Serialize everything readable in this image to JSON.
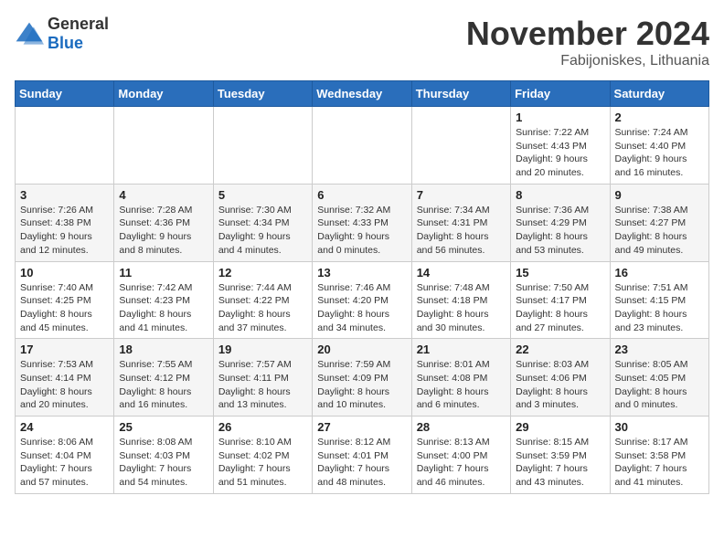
{
  "logo": {
    "text_general": "General",
    "text_blue": "Blue"
  },
  "title": "November 2024",
  "subtitle": "Fabijoniskes, Lithuania",
  "days_of_week": [
    "Sunday",
    "Monday",
    "Tuesday",
    "Wednesday",
    "Thursday",
    "Friday",
    "Saturday"
  ],
  "weeks": [
    [
      {
        "day": "",
        "info": ""
      },
      {
        "day": "",
        "info": ""
      },
      {
        "day": "",
        "info": ""
      },
      {
        "day": "",
        "info": ""
      },
      {
        "day": "",
        "info": ""
      },
      {
        "day": "1",
        "info": "Sunrise: 7:22 AM\nSunset: 4:43 PM\nDaylight: 9 hours\nand 20 minutes."
      },
      {
        "day": "2",
        "info": "Sunrise: 7:24 AM\nSunset: 4:40 PM\nDaylight: 9 hours\nand 16 minutes."
      }
    ],
    [
      {
        "day": "3",
        "info": "Sunrise: 7:26 AM\nSunset: 4:38 PM\nDaylight: 9 hours\nand 12 minutes."
      },
      {
        "day": "4",
        "info": "Sunrise: 7:28 AM\nSunset: 4:36 PM\nDaylight: 9 hours\nand 8 minutes."
      },
      {
        "day": "5",
        "info": "Sunrise: 7:30 AM\nSunset: 4:34 PM\nDaylight: 9 hours\nand 4 minutes."
      },
      {
        "day": "6",
        "info": "Sunrise: 7:32 AM\nSunset: 4:33 PM\nDaylight: 9 hours\nand 0 minutes."
      },
      {
        "day": "7",
        "info": "Sunrise: 7:34 AM\nSunset: 4:31 PM\nDaylight: 8 hours\nand 56 minutes."
      },
      {
        "day": "8",
        "info": "Sunrise: 7:36 AM\nSunset: 4:29 PM\nDaylight: 8 hours\nand 53 minutes."
      },
      {
        "day": "9",
        "info": "Sunrise: 7:38 AM\nSunset: 4:27 PM\nDaylight: 8 hours\nand 49 minutes."
      }
    ],
    [
      {
        "day": "10",
        "info": "Sunrise: 7:40 AM\nSunset: 4:25 PM\nDaylight: 8 hours\nand 45 minutes."
      },
      {
        "day": "11",
        "info": "Sunrise: 7:42 AM\nSunset: 4:23 PM\nDaylight: 8 hours\nand 41 minutes."
      },
      {
        "day": "12",
        "info": "Sunrise: 7:44 AM\nSunset: 4:22 PM\nDaylight: 8 hours\nand 37 minutes."
      },
      {
        "day": "13",
        "info": "Sunrise: 7:46 AM\nSunset: 4:20 PM\nDaylight: 8 hours\nand 34 minutes."
      },
      {
        "day": "14",
        "info": "Sunrise: 7:48 AM\nSunset: 4:18 PM\nDaylight: 8 hours\nand 30 minutes."
      },
      {
        "day": "15",
        "info": "Sunrise: 7:50 AM\nSunset: 4:17 PM\nDaylight: 8 hours\nand 27 minutes."
      },
      {
        "day": "16",
        "info": "Sunrise: 7:51 AM\nSunset: 4:15 PM\nDaylight: 8 hours\nand 23 minutes."
      }
    ],
    [
      {
        "day": "17",
        "info": "Sunrise: 7:53 AM\nSunset: 4:14 PM\nDaylight: 8 hours\nand 20 minutes."
      },
      {
        "day": "18",
        "info": "Sunrise: 7:55 AM\nSunset: 4:12 PM\nDaylight: 8 hours\nand 16 minutes."
      },
      {
        "day": "19",
        "info": "Sunrise: 7:57 AM\nSunset: 4:11 PM\nDaylight: 8 hours\nand 13 minutes."
      },
      {
        "day": "20",
        "info": "Sunrise: 7:59 AM\nSunset: 4:09 PM\nDaylight: 8 hours\nand 10 minutes."
      },
      {
        "day": "21",
        "info": "Sunrise: 8:01 AM\nSunset: 4:08 PM\nDaylight: 8 hours\nand 6 minutes."
      },
      {
        "day": "22",
        "info": "Sunrise: 8:03 AM\nSunset: 4:06 PM\nDaylight: 8 hours\nand 3 minutes."
      },
      {
        "day": "23",
        "info": "Sunrise: 8:05 AM\nSunset: 4:05 PM\nDaylight: 8 hours\nand 0 minutes."
      }
    ],
    [
      {
        "day": "24",
        "info": "Sunrise: 8:06 AM\nSunset: 4:04 PM\nDaylight: 7 hours\nand 57 minutes."
      },
      {
        "day": "25",
        "info": "Sunrise: 8:08 AM\nSunset: 4:03 PM\nDaylight: 7 hours\nand 54 minutes."
      },
      {
        "day": "26",
        "info": "Sunrise: 8:10 AM\nSunset: 4:02 PM\nDaylight: 7 hours\nand 51 minutes."
      },
      {
        "day": "27",
        "info": "Sunrise: 8:12 AM\nSunset: 4:01 PM\nDaylight: 7 hours\nand 48 minutes."
      },
      {
        "day": "28",
        "info": "Sunrise: 8:13 AM\nSunset: 4:00 PM\nDaylight: 7 hours\nand 46 minutes."
      },
      {
        "day": "29",
        "info": "Sunrise: 8:15 AM\nSunset: 3:59 PM\nDaylight: 7 hours\nand 43 minutes."
      },
      {
        "day": "30",
        "info": "Sunrise: 8:17 AM\nSunset: 3:58 PM\nDaylight: 7 hours\nand 41 minutes."
      }
    ]
  ]
}
